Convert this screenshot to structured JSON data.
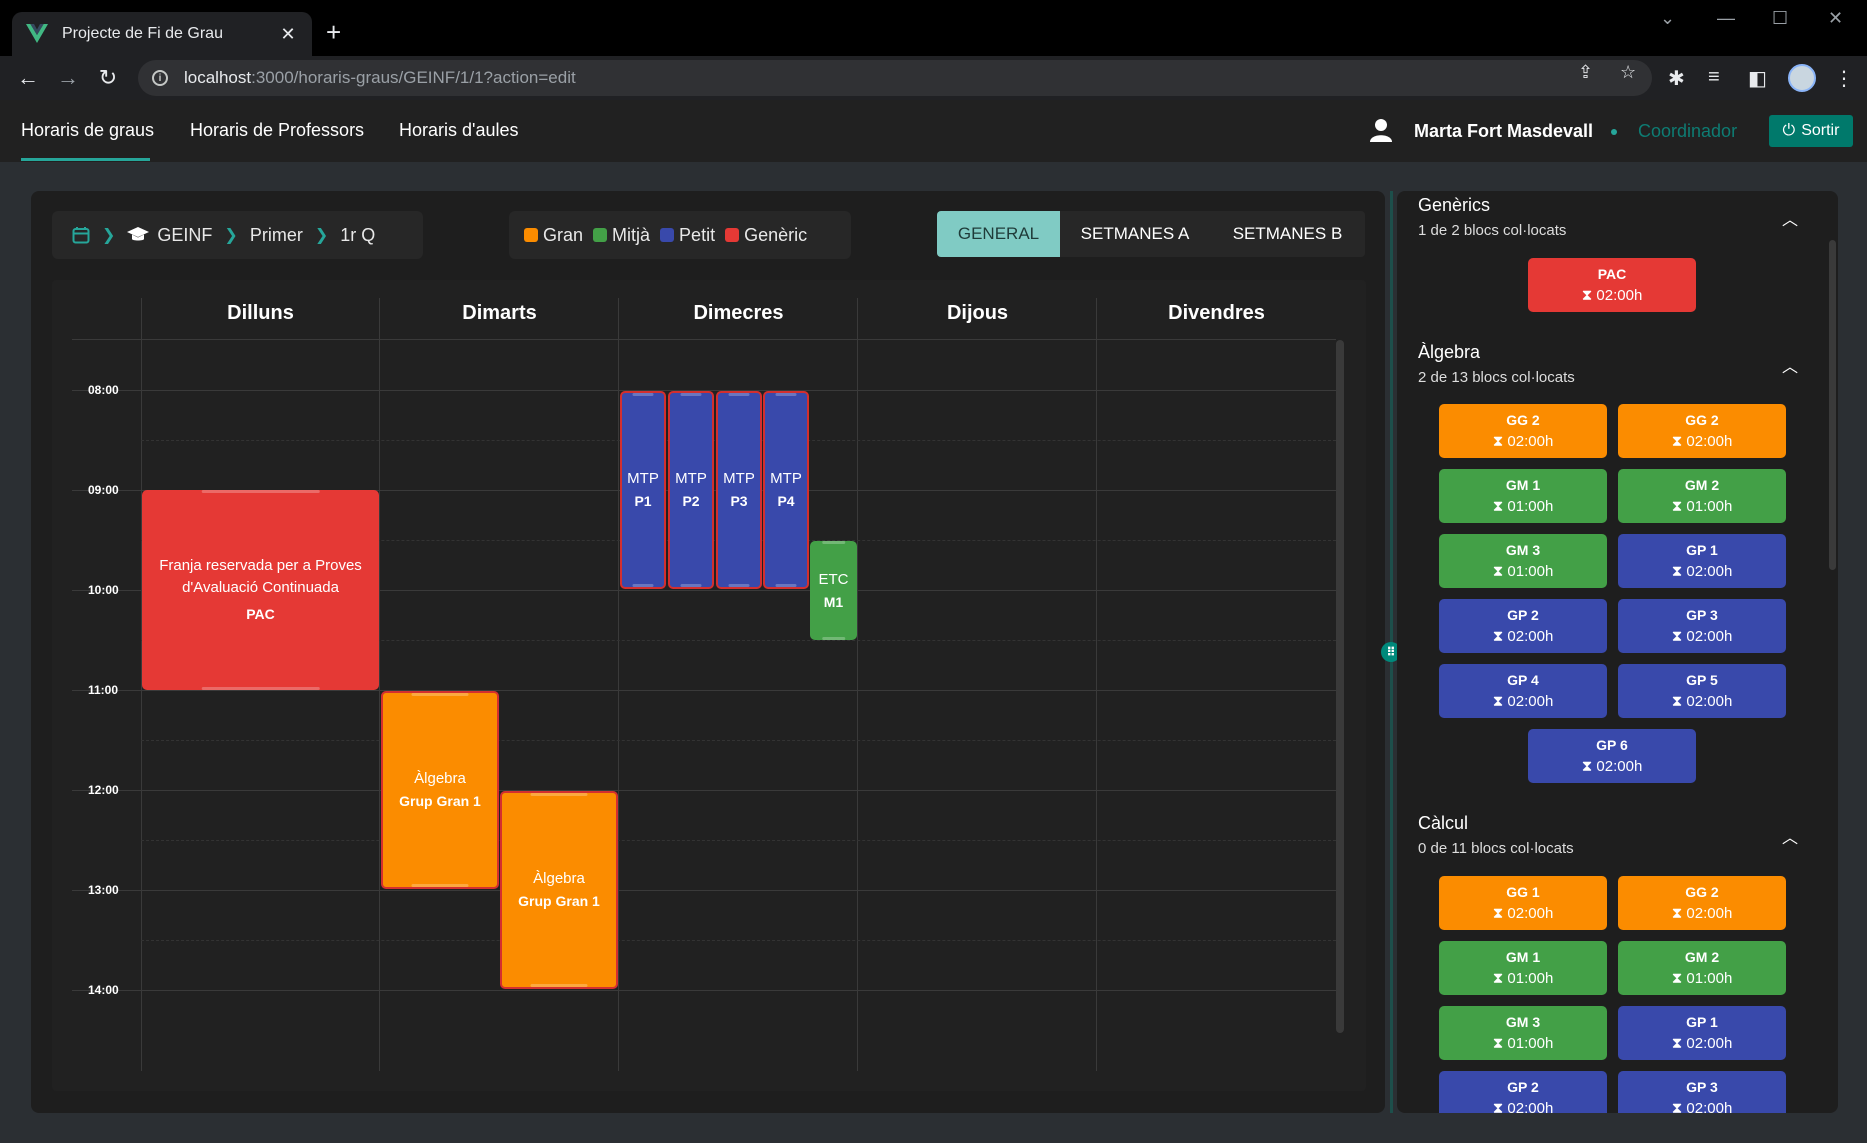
{
  "browser": {
    "tab_title": "Projecte de Fi de Grau",
    "url_host": "localhost",
    "url_path": ":3000/horaris-graus/GEINF/1/1?action=edit"
  },
  "header": {
    "nav": [
      "Horaris de graus",
      "Horaris de Professors",
      "Horaris d'aules"
    ],
    "user_name": "Marta Fort Masdevall",
    "role": "Coordinador",
    "logout_label": "Sortir"
  },
  "breadcrumb": [
    "GEINF",
    "Primer",
    "1r Q"
  ],
  "legend": [
    {
      "label": "Gran",
      "color": "#fb8c00"
    },
    {
      "label": "Mitjà",
      "color": "#43a047"
    },
    {
      "label": "Petit",
      "color": "#3949ab"
    },
    {
      "label": "Genèric",
      "color": "#e53935"
    }
  ],
  "view_tabs": [
    "GENERAL",
    "SETMANES A",
    "SETMANES B"
  ],
  "calendar": {
    "days": [
      "Dilluns",
      "Dimarts",
      "Dimecres",
      "Dijous",
      "Divendres"
    ],
    "times": [
      "08:00",
      "09:00",
      "10:00",
      "11:00",
      "12:00",
      "13:00",
      "14:00"
    ],
    "events": {
      "pac": {
        "line1": "Franja reservada per a Proves",
        "line2": "d'Avaluació Continuada",
        "code": "PAC"
      },
      "alg1": {
        "subject": "Àlgebra",
        "group": "Grup Gran 1"
      },
      "alg2": {
        "subject": "Àlgebra",
        "group": "Grup Gran 1"
      },
      "mtp1": {
        "subject": "MTP",
        "group": "P1"
      },
      "mtp2": {
        "subject": "MTP",
        "group": "P2"
      },
      "mtp3": {
        "subject": "MTP",
        "group": "P3"
      },
      "mtp4": {
        "subject": "MTP",
        "group": "P4"
      },
      "etc": {
        "subject": "ETC",
        "group": "M1"
      }
    }
  },
  "side": {
    "generics": {
      "title": "Genèrics",
      "subtitle": "1 de 2 blocs col·locats",
      "blocks": [
        {
          "name": "PAC",
          "duration": "02:00h"
        }
      ]
    },
    "algebra": {
      "title": "Àlgebra",
      "subtitle": "2 de 13 blocs col·locats",
      "blocks": [
        {
          "name": "GG 2",
          "duration": "02:00h"
        },
        {
          "name": "GG 2",
          "duration": "02:00h"
        },
        {
          "name": "GM 1",
          "duration": "01:00h"
        },
        {
          "name": "GM 2",
          "duration": "01:00h"
        },
        {
          "name": "GM 3",
          "duration": "01:00h"
        },
        {
          "name": "GP 1",
          "duration": "02:00h"
        },
        {
          "name": "GP 2",
          "duration": "02:00h"
        },
        {
          "name": "GP 3",
          "duration": "02:00h"
        },
        {
          "name": "GP 4",
          "duration": "02:00h"
        },
        {
          "name": "GP 5",
          "duration": "02:00h"
        },
        {
          "name": "GP 6",
          "duration": "02:00h"
        }
      ]
    },
    "calcul": {
      "title": "Càlcul",
      "subtitle": "0 de 11 blocs col·locats",
      "blocks": [
        {
          "name": "GG 1",
          "duration": "02:00h"
        },
        {
          "name": "GG 2",
          "duration": "02:00h"
        },
        {
          "name": "GM 1",
          "duration": "01:00h"
        },
        {
          "name": "GM 2",
          "duration": "01:00h"
        },
        {
          "name": "GM 3",
          "duration": "01:00h"
        },
        {
          "name": "GP 1",
          "duration": "02:00h"
        },
        {
          "name": "GP 2",
          "duration": "02:00h"
        },
        {
          "name": "GP 3",
          "duration": "02:00h"
        }
      ]
    }
  }
}
